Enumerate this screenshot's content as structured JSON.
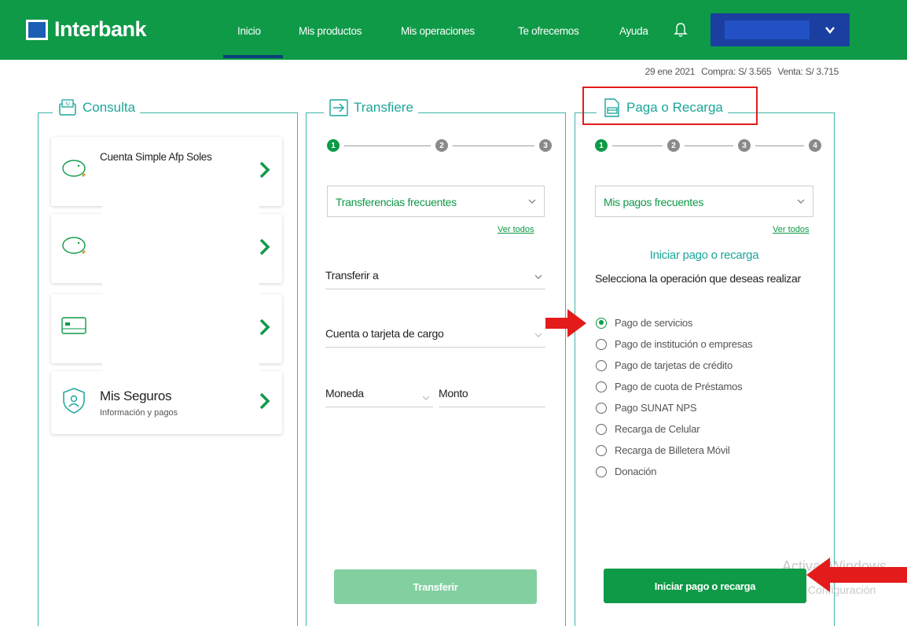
{
  "brand": {
    "name": "Interbank"
  },
  "nav": {
    "items": [
      {
        "label": "Inicio",
        "active": true
      },
      {
        "label": "Mis productos"
      },
      {
        "label": "Mis operaciones"
      },
      {
        "label": "Te ofrecemos"
      },
      {
        "label": "Ayuda"
      }
    ]
  },
  "rates": {
    "date": "29 ene 2021",
    "buy": "Compra: S/ 3.565",
    "sell": "Venta: S/ 3.715"
  },
  "consulta": {
    "title": "Consulta",
    "cards": [
      {
        "title": "Cuenta Simple Afp Soles",
        "subtitle": ""
      },
      {
        "title": "",
        "subtitle": ""
      },
      {
        "title": "",
        "subtitle": ""
      },
      {
        "title": "Mis Seguros",
        "subtitle": "Información y pagos"
      }
    ]
  },
  "transfiere": {
    "title": "Transfiere",
    "steps": [
      "1",
      "2",
      "3"
    ],
    "frequent": "Transferencias frecuentes",
    "see_all": "Ver todos",
    "to": "Transferir a",
    "from": "Cuenta o tarjeta de cargo",
    "currency": "Moneda",
    "amount": "Monto",
    "button": "Transferir"
  },
  "paga": {
    "title": "Paga o Recarga",
    "steps": [
      "1",
      "2",
      "3",
      "4"
    ],
    "frequent": "Mis pagos frecuentes",
    "see_all": "Ver todos",
    "heading": "Iniciar pago o recarga",
    "prompt": "Selecciona la operación que deseas realizar",
    "options": [
      "Pago de servicios",
      "Pago de institución o empresas",
      "Pago de tarjetas de crédito",
      "Pago de cuota de Préstamos",
      "Pago SUNAT NPS",
      "Recarga de Celular",
      "Recarga de Billetera Móvil",
      "Donación"
    ],
    "selected_index": 0,
    "button": "Iniciar pago o recarga"
  },
  "watermark": {
    "line1": "Activar Windows",
    "line2": "Ve a Configuración"
  },
  "colors": {
    "brand_green": "#0e9a47",
    "teal": "#1ba69a",
    "navy": "#1a3fa0",
    "annotation_red": "#e41b1b"
  }
}
